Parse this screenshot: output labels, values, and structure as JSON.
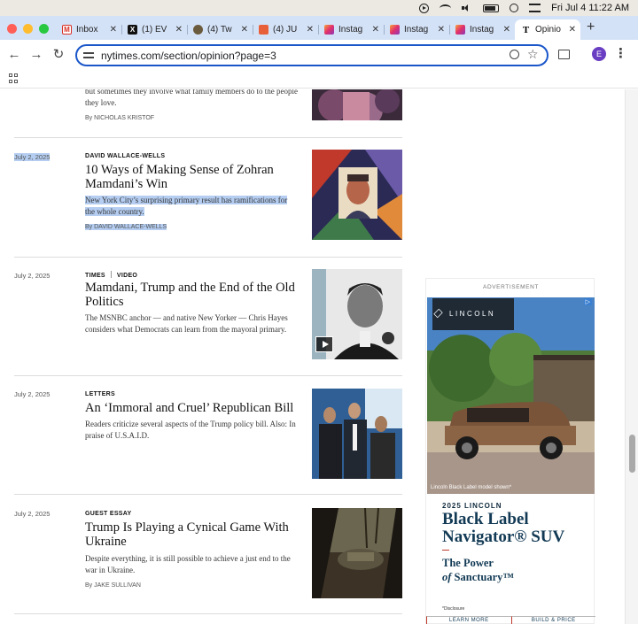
{
  "menubar": {
    "clock": "Fri Jul 4  11:22 AM"
  },
  "tabs": [
    {
      "title": "Inbox",
      "favicon": "gmail-icon",
      "fav_text": "M"
    },
    {
      "title": "(1) EV",
      "favicon": "x-icon",
      "fav_text": "X"
    },
    {
      "title": "(4) Tw",
      "favicon": "twitter-avatar-icon",
      "fav_text": ""
    },
    {
      "title": "(4) JU",
      "favicon": "bookmark-red-icon",
      "fav_text": ""
    },
    {
      "title": "Instag",
      "favicon": "instagram-icon",
      "fav_text": ""
    },
    {
      "title": "Instag",
      "favicon": "instagram-icon",
      "fav_text": ""
    },
    {
      "title": "Instag",
      "favicon": "instagram-icon",
      "fav_text": ""
    },
    {
      "title": "Opinio",
      "favicon": "nyt-icon",
      "fav_text": "T",
      "active": true
    }
  ],
  "toolbar": {
    "url": "nytimes.com/section/opinion?page=3",
    "avatar_letter": "E"
  },
  "articles": [
    {
      "date": "",
      "kicker": "",
      "headline": "",
      "summary": "but sometimes they involve what family members do to the people they love.",
      "byline": "By NICHOLAS KRISTOF"
    },
    {
      "date": "July 2, 2025",
      "kicker": "DAVID WALLACE-WELLS",
      "headline": "10 Ways of Making Sense of Zohran Mamdani’s Win",
      "summary": "New York City’s surprising primary result has ramifications for the whole country.",
      "byline": "By DAVID WALLACE-WELLS"
    },
    {
      "date": "July 2, 2025",
      "kicker_a": "TIMES",
      "kicker_b": "VIDEO",
      "headline": "Mamdani, Trump and the End of the Old Politics",
      "summary": "The MSNBC anchor — and native New Yorker — Chris Hayes considers what Democrats can learn from the mayoral primary.",
      "byline": ""
    },
    {
      "date": "July 2, 2025",
      "kicker": "LETTERS",
      "headline": "An ‘Immoral and Cruel’ Republican Bill",
      "summary": "Readers criticize several aspects of the Trump policy bill. Also: In praise of U.S.A.I.D.",
      "byline": ""
    },
    {
      "date": "July 2, 2025",
      "kicker": "GUEST ESSAY",
      "headline": "Trump Is Playing a Cynical Game With Ukraine",
      "summary": "Despite everything, it is still possible to achieve a just end to the war in Ukraine.",
      "byline": "By JAKE SULLIVAN"
    }
  ],
  "ad": {
    "label": "ADVERTISEMENT",
    "brand": "LINCOLN",
    "caption": "Lincoln Black Label model shown*",
    "year": "2025 LINCOLN",
    "title": "Black Label Navigator® SUV",
    "tagline_1": "The Power",
    "tagline_2_italic": "of",
    "tagline_2": " Sanctuary™",
    "disclosure": "*Disclosure",
    "cta_left": "LEARN MORE",
    "cta_right": "BUILD & PRICE"
  },
  "colors": {
    "selection": "#b4cdf1",
    "omnibox_focus": "#1a56c9",
    "tabstrip": "#d4e2f7",
    "lincoln_navy": "#123a55"
  }
}
